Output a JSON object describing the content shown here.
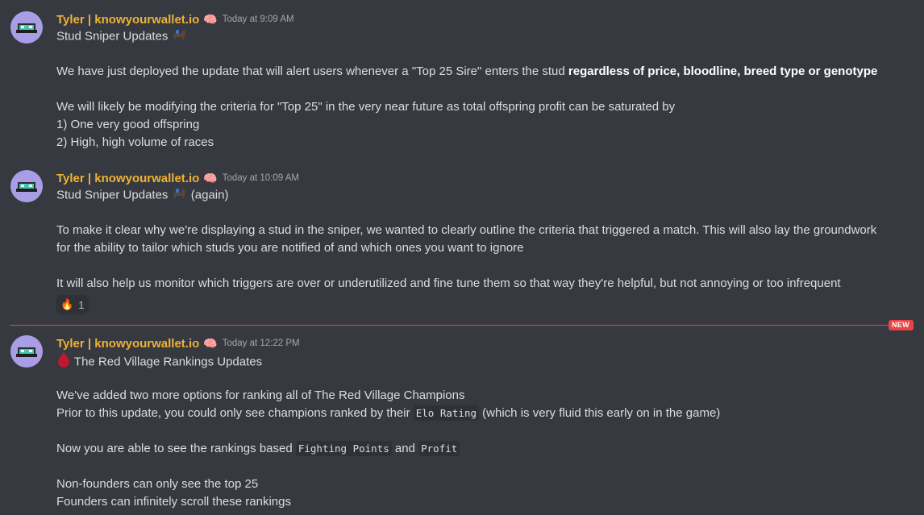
{
  "messages": [
    {
      "username": "Tyler | knowyourwallet.io",
      "badge_emoji": "🧠",
      "timestamp": "Today at 9:09 AM",
      "lines": [
        {
          "text": "Stud Sniper Updates"
        },
        {
          "pre": "We have just deployed the update that will alert users whenever a \"Top 25 Sire\" enters the stud ",
          "bold": "regardless of price, bloodline, breed type or genotype"
        },
        {
          "text": "We will likely be modifying the criteria for \"Top 25\" in the very near future as total offspring profit can be saturated by"
        },
        {
          "text": "1) One very good offspring"
        },
        {
          "text": "2) High, high volume of races"
        }
      ]
    },
    {
      "username": "Tyler | knowyourwallet.io",
      "badge_emoji": "🧠",
      "timestamp": "Today at 10:09 AM",
      "lines": [
        {
          "text": "Stud Sniper Updates",
          "suffix": "(again)"
        },
        {
          "text": "To make it clear why we're displaying a stud in the sniper, we wanted to clearly outline the criteria that triggered a match. This will also lay the groundwork"
        },
        {
          "text": "for the ability to tailor which studs you are notified of and which ones you want to ignore"
        },
        {
          "text": "It will also help us monitor which triggers are over or underutilized and fine tune them so that way they're helpful, but not annoying or too infrequent"
        }
      ],
      "reaction": {
        "emoji": "🔥",
        "count": "1"
      }
    },
    {
      "username": "Tyler | knowyourwallet.io",
      "badge_emoji": "🧠",
      "timestamp": "Today at 12:22 PM",
      "lines": [
        {
          "text": "The Red Village Rankings Updates"
        },
        {
          "text": "We've added two more options for ranking all of The Red Village Champions"
        },
        {
          "pre": "Prior to this update, you could only see champions ranked by their ",
          "code": "Elo Rating",
          "post": " (which is very fluid this early on in the game)"
        },
        {
          "pre": "Now you are able to see the rankings based ",
          "code": "Fighting Points",
          "mid": " and ",
          "code2": "Profit"
        },
        {
          "text": "Non-founders can only see the top 25"
        },
        {
          "text": "Founders can infinitely scroll these rankings"
        }
      ]
    }
  ],
  "new_divider_label": "NEW",
  "colors": {
    "background": "#36393f",
    "username": "#f0b232",
    "divider": "#ed4245",
    "text": "#dcddde"
  }
}
